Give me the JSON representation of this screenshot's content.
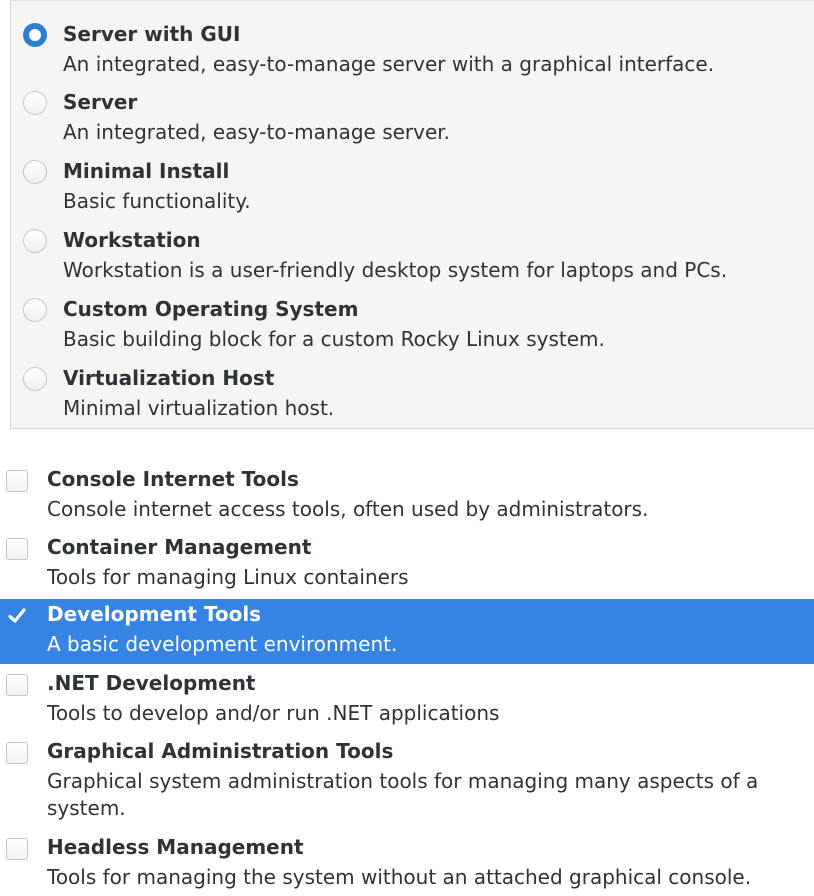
{
  "environments": [
    {
      "title": "Server with GUI",
      "description": "An integrated, easy-to-manage server with a graphical interface.",
      "selected": true
    },
    {
      "title": "Server",
      "description": "An integrated, easy-to-manage server.",
      "selected": false
    },
    {
      "title": "Minimal Install",
      "description": "Basic functionality.",
      "selected": false
    },
    {
      "title": "Workstation",
      "description": "Workstation is a user-friendly desktop system for laptops and PCs.",
      "selected": false
    },
    {
      "title": "Custom Operating System",
      "description": "Basic building block for a custom Rocky Linux system.",
      "selected": false
    },
    {
      "title": "Virtualization Host",
      "description": "Minimal virtualization host.",
      "selected": false
    }
  ],
  "addons": [
    {
      "title": "Console Internet Tools",
      "description": "Console internet access tools, often used by administrators.",
      "checked": false
    },
    {
      "title": "Container Management",
      "description": "Tools for managing Linux containers",
      "checked": false
    },
    {
      "title": "Development Tools",
      "description": "A basic development environment.",
      "checked": true
    },
    {
      "title": ".NET Development",
      "description": "Tools to develop and/or run .NET applications",
      "checked": false
    },
    {
      "title": "Graphical Administration Tools",
      "description": "Graphical system administration tools for managing many aspects of a system.",
      "checked": false
    },
    {
      "title": "Headless Management",
      "description": "Tools for managing the system without an attached graphical console.",
      "checked": false
    }
  ],
  "colors": {
    "radio_selected": "#2c7ed6",
    "row_selected": "#3584e4"
  }
}
